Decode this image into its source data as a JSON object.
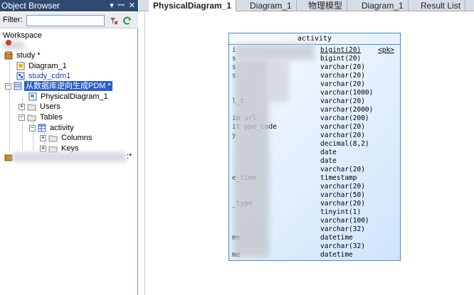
{
  "object_browser": {
    "title": "Object Browser",
    "pin_glyph": "▾ ꟷ ✕",
    "filter_label": "Filter:",
    "filter_value": "",
    "tree": {
      "workspace": "Workspace",
      "study": "study *",
      "diagram1": "Diagram_1",
      "study_cdm1": "study_cdm1",
      "pdm": "从数据库逆向生成PDM *",
      "physical_diagram": "PhysicalDiagram_1",
      "users": "Users",
      "tables": "Tables",
      "activity": "activity",
      "columns": "Columns",
      "keys": "Keys",
      "trailing_mark": ":*"
    }
  },
  "tabs": [
    {
      "label": "PhysicalDiagram_1",
      "active": true
    },
    {
      "label": "Diagram_1",
      "active": false
    },
    {
      "label": "物理模型",
      "active": false
    },
    {
      "label": "Diagram_1",
      "active": false
    },
    {
      "label": "Result List",
      "active": false
    }
  ],
  "entity": {
    "name": "activity",
    "rows": [
      {
        "name": "i",
        "type": "bigint(20)",
        "key": "<pk>",
        "type_underlined": true
      },
      {
        "name": "s",
        "type": "bigint(20)",
        "key": ""
      },
      {
        "name": "s",
        "type": "varchar(20)",
        "key": ""
      },
      {
        "name": "s",
        "type": "varchar(20)",
        "key": ""
      },
      {
        "name": "",
        "type": "varchar(20)",
        "key": ""
      },
      {
        "name": "",
        "type": "varchar(1000)",
        "key": ""
      },
      {
        "name": "l_t",
        "type": "varchar(20)",
        "key": ""
      },
      {
        "name": "",
        "type": "varchar(2000)",
        "key": ""
      },
      {
        "name": "im url",
        "type": "varchar(200)",
        "key": ""
      },
      {
        "name": "it ype_code",
        "type": "varchar(20)",
        "key": ""
      },
      {
        "name": "y",
        "type": "varchar(20)",
        "key": ""
      },
      {
        "name": "",
        "type": "decimal(8,2)",
        "key": ""
      },
      {
        "name": "",
        "type": "date",
        "key": ""
      },
      {
        "name": "",
        "type": "date",
        "key": ""
      },
      {
        "name": "",
        "type": "varchar(20)",
        "key": ""
      },
      {
        "name": "e_time",
        "type": "timestamp",
        "key": ""
      },
      {
        "name": "",
        "type": "varchar(20)",
        "key": ""
      },
      {
        "name": "",
        "type": "varchar(50)",
        "key": ""
      },
      {
        "name": "_type",
        "type": "varchar(20)",
        "key": ""
      },
      {
        "name": "",
        "type": "tinyint(1)",
        "key": ""
      },
      {
        "name": "",
        "type": "varchar(100)",
        "key": ""
      },
      {
        "name": "",
        "type": "varchar(32)",
        "key": ""
      },
      {
        "name": "me",
        "type": "datetime",
        "key": ""
      },
      {
        "name": "",
        "type": "varchar(32)",
        "key": ""
      },
      {
        "name": "me",
        "type": "datetime",
        "key": ""
      }
    ]
  },
  "colors": {
    "panel_title_bg": "#2f4a71",
    "selection": "#2d5fc9",
    "entity_border": "#4a8cc9"
  }
}
